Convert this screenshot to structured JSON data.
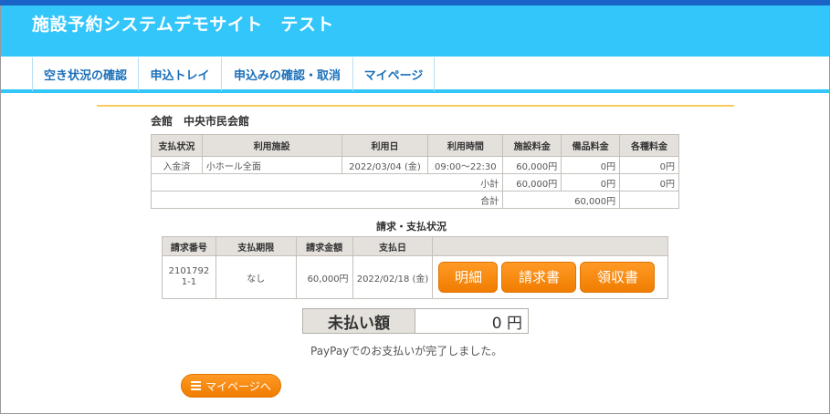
{
  "site": {
    "title": "施設予約システムデモサイト　テスト"
  },
  "nav": [
    {
      "label": "空き状況の確認"
    },
    {
      "label": "申込トレイ"
    },
    {
      "label": "申込みの確認・取消"
    },
    {
      "label": "マイページ"
    }
  ],
  "venue": "会館　中央市民会館",
  "booking_table": {
    "headers": [
      "支払状況",
      "利用施設",
      "利用日",
      "利用時間",
      "施設料金",
      "備品料金",
      "各種料金"
    ],
    "row": {
      "status": "入金済",
      "facility": "小ホール全面",
      "date": "2022/03/04 (金)",
      "time": "09:00～22:30",
      "facility_fee": "60,000円",
      "equipment_fee": "0円",
      "other_fee": "0円"
    },
    "subtotal": {
      "label": "小計",
      "facility_fee": "60,000円",
      "equipment_fee": "0円",
      "other_fee": "0円"
    },
    "total": {
      "label": "合計",
      "value": "60,000円"
    }
  },
  "billing": {
    "title": "請求・支払状況",
    "headers": [
      "請求番号",
      "支払期限",
      "請求金額",
      "支払日",
      ""
    ],
    "row": {
      "invoice_no": "21017921-1",
      "deadline": "なし",
      "amount": "60,000円",
      "paid_date": "2022/02/18 (金)"
    },
    "buttons": {
      "detail": "明細",
      "invoice": "請求書",
      "receipt": "領収書"
    }
  },
  "unpaid": {
    "label": "未払い額",
    "value": "0 円"
  },
  "message": "PayPayでのお支払いが完了しました。",
  "mypage_button": "マイページへ",
  "colors": {
    "header": "#33c6fb",
    "accent": "#f07d00",
    "nav_text": "#1a6fb9"
  }
}
